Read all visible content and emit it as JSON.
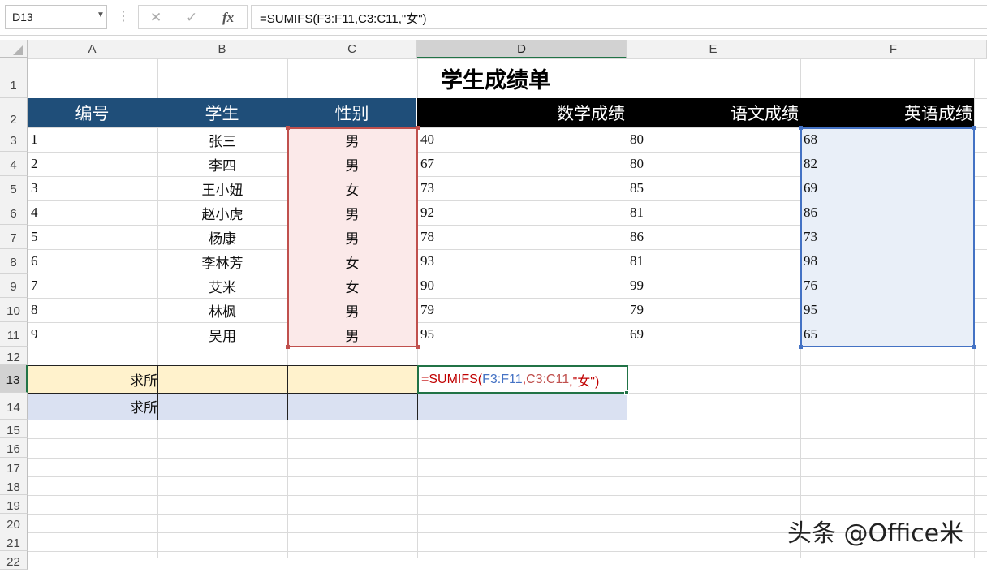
{
  "name_box": "D13",
  "formula_bar": {
    "cancel_icon": "✕",
    "enter_icon": "✓",
    "fx_label": "fx",
    "formula": "=SUMIFS(F3:F11,C3:C11,\"女\")"
  },
  "columns": [
    "A",
    "B",
    "C",
    "D",
    "E",
    "F"
  ],
  "rows": [
    "1",
    "2",
    "3",
    "4",
    "5",
    "6",
    "7",
    "8",
    "9",
    "10",
    "11",
    "12",
    "13",
    "14",
    "15",
    "16",
    "17",
    "18",
    "19",
    "20",
    "21",
    "22"
  ],
  "title": "学生成绩单",
  "headers": [
    "编号",
    "学生",
    "性别",
    "数学成绩",
    "语文成绩",
    "英语成绩"
  ],
  "records": [
    [
      "1",
      "张三",
      "男",
      "40",
      "80",
      "68"
    ],
    [
      "2",
      "李四",
      "男",
      "67",
      "80",
      "82"
    ],
    [
      "3",
      "王小妞",
      "女",
      "73",
      "85",
      "69"
    ],
    [
      "4",
      "赵小虎",
      "男",
      "92",
      "81",
      "86"
    ],
    [
      "5",
      "杨康",
      "男",
      "78",
      "86",
      "73"
    ],
    [
      "6",
      "李林芳",
      "女",
      "93",
      "81",
      "98"
    ],
    [
      "7",
      "艾米",
      "女",
      "90",
      "99",
      "76"
    ],
    [
      "8",
      "林枫",
      "男",
      "79",
      "79",
      "95"
    ],
    [
      "9",
      "吴用",
      "男",
      "95",
      "69",
      "65"
    ]
  ],
  "row13_label": "求所",
  "row14_label": "求所",
  "edit_formula": {
    "eq": "=SUMIFS(",
    "range1": "F3:F11",
    "comma1": ",",
    "range2": "C3:C11",
    "tail": ",\"女\")"
  },
  "colors": {
    "range1": "#4472c4",
    "range2": "#c0504d",
    "active_border": "#217346"
  },
  "watermark": "头条 @Office米"
}
